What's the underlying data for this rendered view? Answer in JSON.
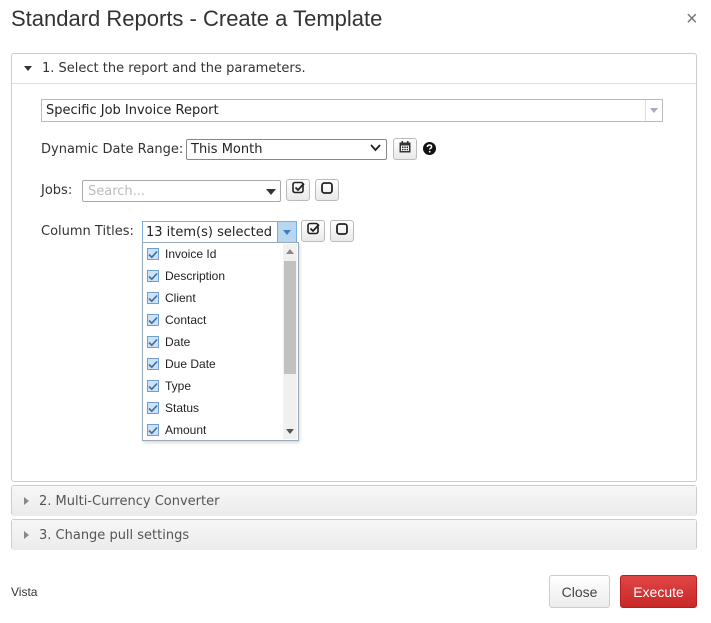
{
  "dialog": {
    "title": "Standard Reports - Create a Template",
    "close_symbol": "×"
  },
  "sections": {
    "section1": {
      "title": "1. Select the report and the parameters.",
      "expanded": true
    },
    "section2": {
      "title": "2. Multi-Currency Converter",
      "expanded": false
    },
    "section3": {
      "title": "3. Change pull settings",
      "expanded": false
    }
  },
  "report": {
    "selected": "Specific Job Invoice Report"
  },
  "date_range": {
    "label": "Dynamic Date Range:",
    "value": "This Month",
    "calendar_icon": "calendar-icon",
    "help_icon": "question-circle-icon"
  },
  "jobs": {
    "label": "Jobs:",
    "placeholder": "Search..."
  },
  "columns": {
    "label": "Column Titles:",
    "summary": "13 item(s) selected",
    "items": [
      {
        "label": "Invoice Id",
        "checked": true
      },
      {
        "label": "Description",
        "checked": true
      },
      {
        "label": "Client",
        "checked": true
      },
      {
        "label": "Contact",
        "checked": true
      },
      {
        "label": "Date",
        "checked": true
      },
      {
        "label": "Due Date",
        "checked": true
      },
      {
        "label": "Type",
        "checked": true
      },
      {
        "label": "Status",
        "checked": true
      },
      {
        "label": "Amount",
        "checked": true
      }
    ]
  },
  "buttons": {
    "select_all_icon": "check-square-icon",
    "clear_icon": "empty-square-icon"
  },
  "footer": {
    "note": "Vista",
    "close_label": "Close",
    "execute_label": "Execute"
  },
  "colors": {
    "accent": "#c82828",
    "dropdown_highlight": "#b9d6f1"
  }
}
